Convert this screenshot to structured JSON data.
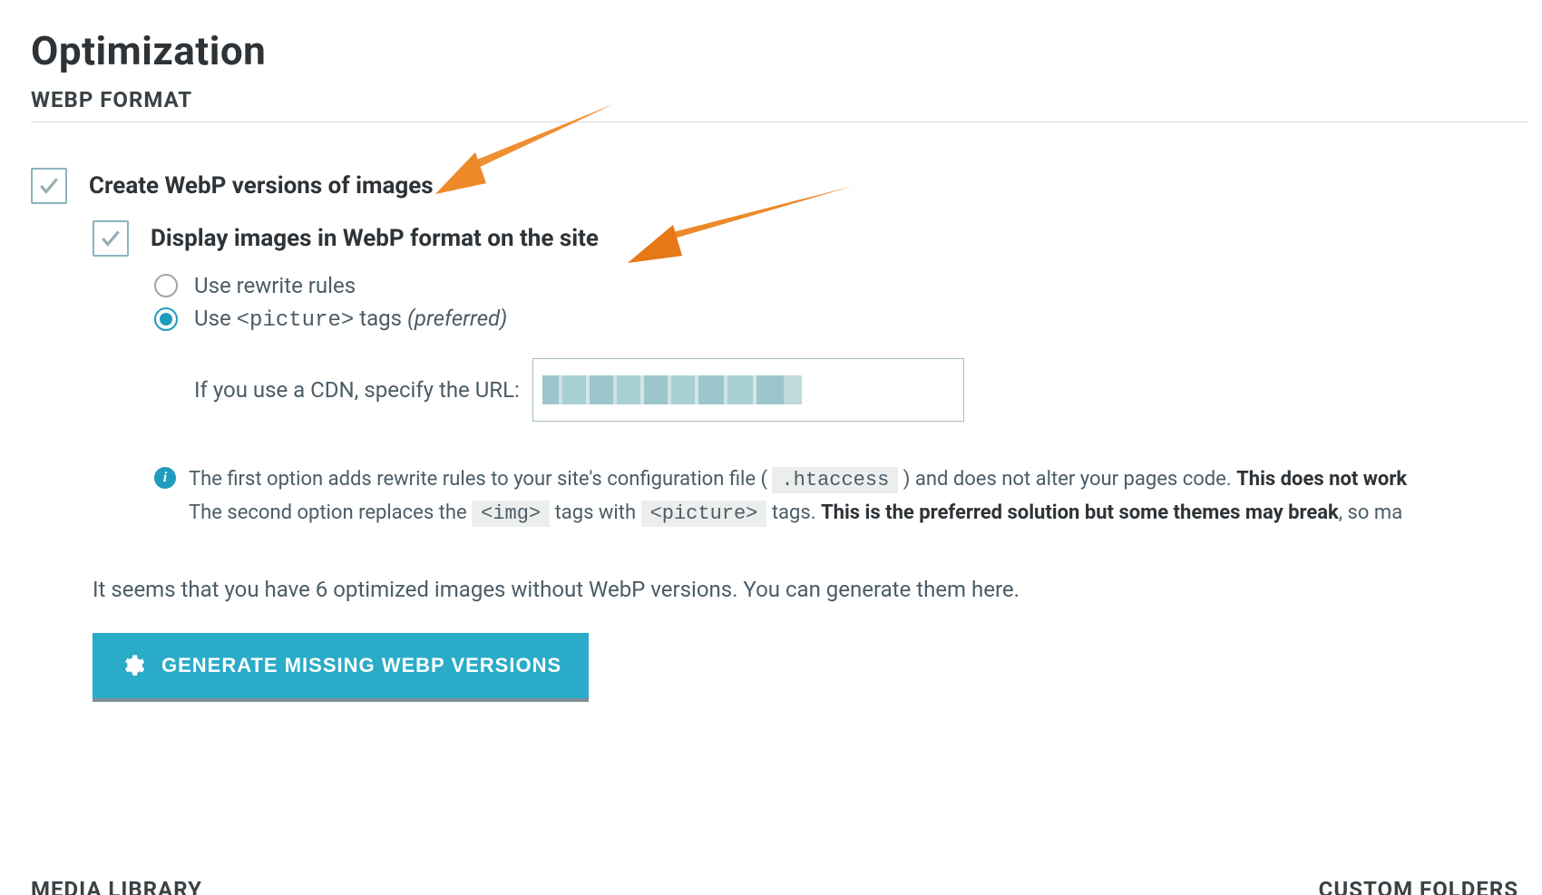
{
  "page_title": "Optimization",
  "section_header": "WEBP FORMAT",
  "option_create": "Create WebP versions of images",
  "option_display": "Display images in WebP format on the site",
  "radio": {
    "rewrite": "Use rewrite rules",
    "picture_pre": "Use ",
    "picture_code": "<picture>",
    "picture_post": " tags ",
    "picture_suffix": "(preferred)"
  },
  "cdn_label": "If you use a CDN, specify the URL:",
  "info_icon_letter": "i",
  "info_line1_a": "The first option adds rewrite rules to your site's configuration file ( ",
  "info_line1_code": ".htaccess",
  "info_line1_b": " ) and does not alter your pages code. ",
  "info_line1_strong": "This does not work",
  "info_line2_a": "The second option replaces the ",
  "info_line2_code1": "<img>",
  "info_line2_b": " tags with ",
  "info_line2_code2": "<picture>",
  "info_line2_c": " tags. ",
  "info_line2_strong": "This is the preferred solution but some themes may break",
  "info_line2_d": ", so ma",
  "status_line": "It seems that you have 6 optimized images without WebP versions. You can generate them here.",
  "generate_button": "GENERATE MISSING WEBP VERSIONS",
  "footer_left": "MEDIA LIBRARY",
  "footer_right": "CUSTOM FOLDERS"
}
